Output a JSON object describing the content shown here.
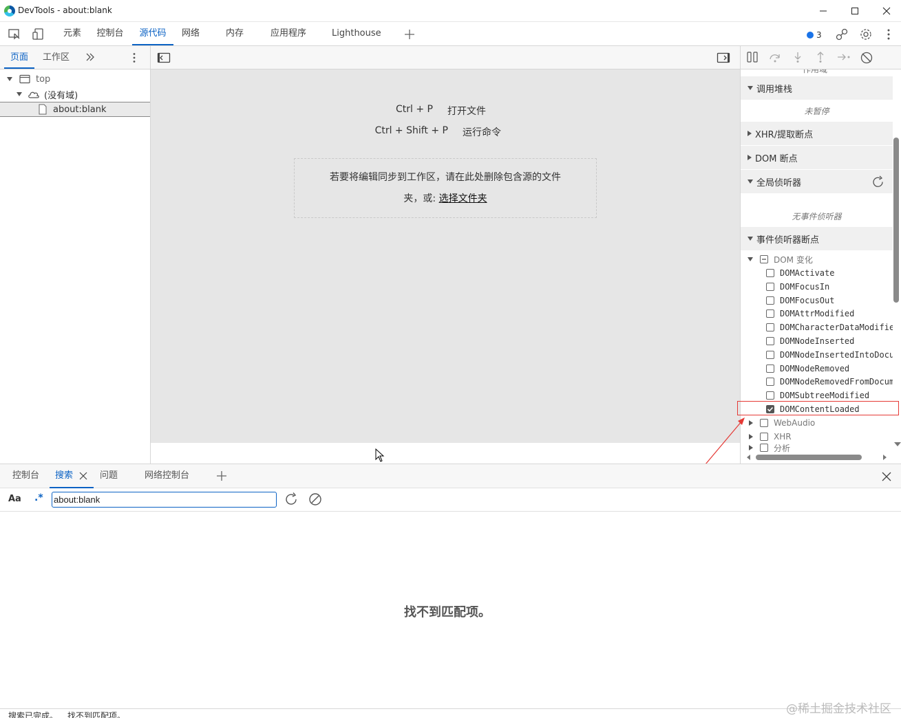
{
  "window": {
    "title": "DevTools - about:blank"
  },
  "main_tabs": [
    "元素",
    "控制台",
    "源代码",
    "网络",
    "内存",
    "应用程序",
    "Lighthouse"
  ],
  "issues_badge": "3",
  "navigator": {
    "tabs": [
      "页面",
      "工作区"
    ],
    "tree": {
      "top": "top",
      "domain": "(没有域)",
      "file": "about:blank"
    }
  },
  "editor": {
    "shortcuts": [
      {
        "key": "Ctrl + P",
        "desc": "打开文件"
      },
      {
        "key": "Ctrl + Shift + P",
        "desc": "运行命令"
      }
    ],
    "sync_text_1": "若要将编辑同步到工作区，请在此处删除包含源的文件",
    "sync_text_2": "夹，或:",
    "pick_folder": "选择文件夹"
  },
  "debugger": {
    "top_partial": "作用域",
    "call_stack": "调用堆栈",
    "not_paused": "未暂停",
    "xhr_breakpoints": "XHR/提取断点",
    "dom_breakpoints": "DOM 断点",
    "global_listeners": "全局侦听器",
    "no_listeners": "无事件侦听器",
    "event_breakpoints": "事件侦听器断点",
    "dom_mutation_group": "DOM 变化",
    "dom_mutation_events": [
      {
        "name": "DOMActivate",
        "checked": false
      },
      {
        "name": "DOMFocusIn",
        "checked": false
      },
      {
        "name": "DOMFocusOut",
        "checked": false
      },
      {
        "name": "DOMAttrModified",
        "checked": false
      },
      {
        "name": "DOMCharacterDataModified",
        "checked": false
      },
      {
        "name": "DOMNodeInserted",
        "checked": false
      },
      {
        "name": "DOMNodeInsertedIntoDocument",
        "checked": false
      },
      {
        "name": "DOMNodeRemoved",
        "checked": false
      },
      {
        "name": "DOMNodeRemovedFromDocument",
        "checked": false
      },
      {
        "name": "DOMSubtreeModified",
        "checked": false
      },
      {
        "name": "DOMContentLoaded",
        "checked": true
      }
    ],
    "other_groups": [
      "WebAudio",
      "XHR",
      "分析"
    ]
  },
  "drawer": {
    "tabs": [
      "控制台",
      "搜索",
      "问题",
      "网络控制台"
    ],
    "active_tab": "搜索",
    "match_case_label": "Aa",
    "regex_label": ".*",
    "search_value": "about:blank",
    "no_match": "找不到匹配项。",
    "status_done": "搜索已完成。",
    "status_nomatch": "找不到匹配项。"
  },
  "watermark": "@稀土掘金技术社区",
  "colors": {
    "accent": "#0b62c4",
    "highlight": "#e53935"
  }
}
